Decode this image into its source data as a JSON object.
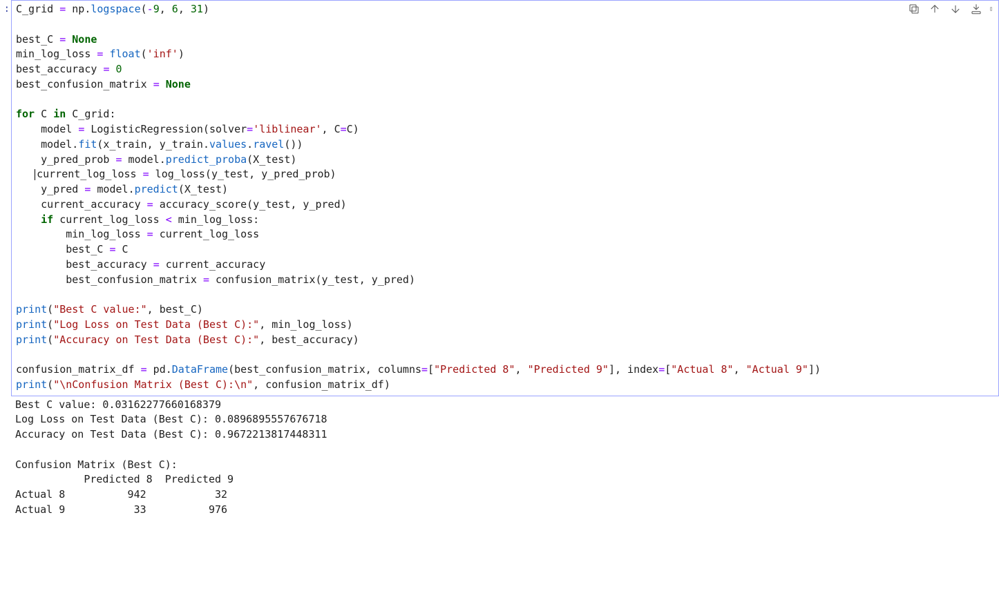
{
  "cell_prompt": ":",
  "toolbar": {
    "copy": "copy-icon",
    "up": "move-up-icon",
    "down": "move-down-icon",
    "insert": "insert-below-icon",
    "more": "more-icon"
  },
  "code_tokens": [
    [
      [
        "id",
        "C_grid"
      ],
      [
        "pn",
        " "
      ],
      [
        "op",
        "="
      ],
      [
        "pn",
        " np"
      ],
      [
        "pn",
        "."
      ],
      [
        "func",
        "logspace"
      ],
      [
        "pn",
        "("
      ],
      [
        "neg",
        "-"
      ],
      [
        "num",
        "9"
      ],
      [
        "pn",
        ", "
      ],
      [
        "num",
        "6"
      ],
      [
        "pn",
        ", "
      ],
      [
        "num",
        "31"
      ],
      [
        "pn",
        ")"
      ]
    ],
    [],
    [
      [
        "id",
        "best_C"
      ],
      [
        "pn",
        " "
      ],
      [
        "op",
        "="
      ],
      [
        "pn",
        " "
      ],
      [
        "bn",
        "None"
      ]
    ],
    [
      [
        "id",
        "min_log_loss"
      ],
      [
        "pn",
        " "
      ],
      [
        "op",
        "="
      ],
      [
        "pn",
        " "
      ],
      [
        "func",
        "float"
      ],
      [
        "pn",
        "("
      ],
      [
        "str",
        "'inf'"
      ],
      [
        "pn",
        ")"
      ]
    ],
    [
      [
        "id",
        "best_accuracy"
      ],
      [
        "pn",
        " "
      ],
      [
        "op",
        "="
      ],
      [
        "pn",
        " "
      ],
      [
        "num",
        "0"
      ]
    ],
    [
      [
        "id",
        "best_confusion_matrix"
      ],
      [
        "pn",
        " "
      ],
      [
        "op",
        "="
      ],
      [
        "pn",
        " "
      ],
      [
        "bn",
        "None"
      ]
    ],
    [],
    [
      [
        "kw",
        "for"
      ],
      [
        "pn",
        " C "
      ],
      [
        "kw",
        "in"
      ],
      [
        "pn",
        " C_grid:"
      ]
    ],
    [
      [
        "pn",
        "    model "
      ],
      [
        "op",
        "="
      ],
      [
        "pn",
        " LogisticRegression(solver"
      ],
      [
        "op",
        "="
      ],
      [
        "str",
        "'liblinear'"
      ],
      [
        "pn",
        ", C"
      ],
      [
        "op",
        "="
      ],
      [
        "pn",
        "C)"
      ]
    ],
    [
      [
        "pn",
        "    model"
      ],
      [
        "pn",
        "."
      ],
      [
        "func",
        "fit"
      ],
      [
        "pn",
        "(x_train, y_train"
      ],
      [
        "pn",
        "."
      ],
      [
        "func",
        "values"
      ],
      [
        "pn",
        "."
      ],
      [
        "func",
        "ravel"
      ],
      [
        "pn",
        "())"
      ]
    ],
    [
      [
        "pn",
        "    y_pred_prob "
      ],
      [
        "op",
        "="
      ],
      [
        "pn",
        " model"
      ],
      [
        "pn",
        "."
      ],
      [
        "func",
        "predict_proba"
      ],
      [
        "pn",
        "(X_test)"
      ]
    ],
    [
      [
        "pn",
        "   "
      ],
      [
        "cursor",
        ""
      ],
      [
        "pn",
        "current_log_loss "
      ],
      [
        "op",
        "="
      ],
      [
        "pn",
        " log_loss(y_test, y_pred_prob)"
      ]
    ],
    [
      [
        "pn",
        "    y_pred "
      ],
      [
        "op",
        "="
      ],
      [
        "pn",
        " model"
      ],
      [
        "pn",
        "."
      ],
      [
        "func",
        "predict"
      ],
      [
        "pn",
        "(X_test)"
      ]
    ],
    [
      [
        "pn",
        "    current_accuracy "
      ],
      [
        "op",
        "="
      ],
      [
        "pn",
        " accuracy_score(y_test, y_pred)"
      ]
    ],
    [
      [
        "pn",
        "    "
      ],
      [
        "kw",
        "if"
      ],
      [
        "pn",
        " current_log_loss "
      ],
      [
        "op",
        "<"
      ],
      [
        "pn",
        " min_log_loss:"
      ]
    ],
    [
      [
        "pn",
        "        min_log_loss "
      ],
      [
        "op",
        "="
      ],
      [
        "pn",
        " current_log_loss"
      ]
    ],
    [
      [
        "pn",
        "        best_C "
      ],
      [
        "op",
        "="
      ],
      [
        "pn",
        " C"
      ]
    ],
    [
      [
        "pn",
        "        best_accuracy "
      ],
      [
        "op",
        "="
      ],
      [
        "pn",
        " current_accuracy"
      ]
    ],
    [
      [
        "pn",
        "        best_confusion_matrix "
      ],
      [
        "op",
        "="
      ],
      [
        "pn",
        " confusion_matrix(y_test, y_pred)"
      ]
    ],
    [],
    [
      [
        "func",
        "print"
      ],
      [
        "pn",
        "("
      ],
      [
        "str",
        "\"Best C value:\""
      ],
      [
        "pn",
        ", best_C)"
      ]
    ],
    [
      [
        "func",
        "print"
      ],
      [
        "pn",
        "("
      ],
      [
        "str",
        "\"Log Loss on Test Data (Best C):\""
      ],
      [
        "pn",
        ", min_log_loss)"
      ]
    ],
    [
      [
        "func",
        "print"
      ],
      [
        "pn",
        "("
      ],
      [
        "str",
        "\"Accuracy on Test Data (Best C):\""
      ],
      [
        "pn",
        ", best_accuracy)"
      ]
    ],
    [],
    [
      [
        "id",
        "confusion_matrix_df"
      ],
      [
        "pn",
        " "
      ],
      [
        "op",
        "="
      ],
      [
        "pn",
        " pd"
      ],
      [
        "pn",
        "."
      ],
      [
        "func",
        "DataFrame"
      ],
      [
        "pn",
        "(best_confusion_matrix, columns"
      ],
      [
        "op",
        "="
      ],
      [
        "pn",
        "["
      ],
      [
        "str",
        "\"Predicted 8\""
      ],
      [
        "pn",
        ", "
      ],
      [
        "str",
        "\"Predicted 9\""
      ],
      [
        "pn",
        "], index"
      ],
      [
        "op",
        "="
      ],
      [
        "pn",
        "["
      ],
      [
        "str",
        "\"Actual 8\""
      ],
      [
        "pn",
        ", "
      ],
      [
        "str",
        "\"Actual 9\""
      ],
      [
        "pn",
        "])"
      ]
    ],
    [
      [
        "func",
        "print"
      ],
      [
        "pn",
        "("
      ],
      [
        "str",
        "\"\\nConfusion Matrix (Best C):\\n\""
      ],
      [
        "pn",
        ", confusion_matrix_df)"
      ]
    ]
  ],
  "output_lines": [
    "Best C value: 0.03162277660168379",
    "Log Loss on Test Data (Best C): 0.0896895557676718",
    "Accuracy on Test Data (Best C): 0.9672213817448311",
    "",
    "Confusion Matrix (Best C):",
    "           Predicted 8  Predicted 9",
    "Actual 8          942           32",
    "Actual 9           33          976"
  ]
}
